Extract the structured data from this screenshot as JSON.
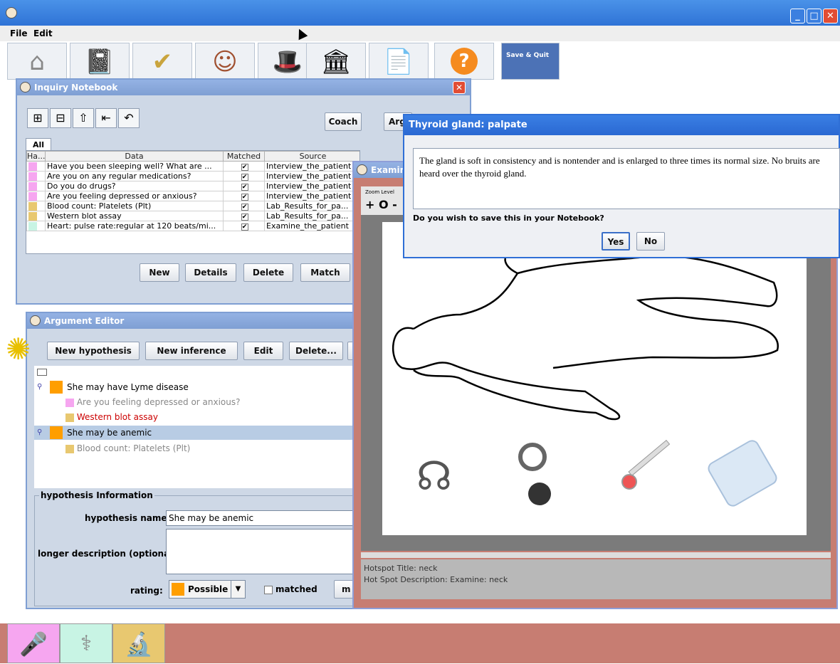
{
  "toolbar": {
    "items": [
      {
        "icon": "house-icon",
        "glyph": "⌂"
      },
      {
        "icon": "notebook-icon",
        "glyph": "📓"
      },
      {
        "icon": "checklist-icon",
        "glyph": "✔"
      },
      {
        "icon": "patient-portrait-icon",
        "glyph": "☺"
      },
      {
        "icon": "hat-icon",
        "glyph": "🎩"
      },
      {
        "icon": "library-building-icon",
        "glyph": "🏛"
      },
      {
        "icon": "report-icon",
        "glyph": "📄"
      },
      {
        "icon": "help-icon",
        "glyph": "?"
      }
    ],
    "save_quit": "Save & Quit"
  },
  "menu": {
    "file": "File",
    "edit": "Edit"
  },
  "inquiry": {
    "title": "Inquiry Notebook",
    "coach": "Coach",
    "arg": "Arg",
    "tab_all": "All",
    "columns": {
      "ha": "Ha...",
      "data": "Data",
      "matched": "Matched",
      "source": "Source"
    },
    "rows": [
      {
        "type": "mic",
        "data": "Have you been sleeping well?  What are ...",
        "matched": "✔",
        "source": "Interview_the_patient"
      },
      {
        "type": "mic",
        "data": "Are you on any regular medications?",
        "matched": "✔",
        "source": "Interview_the_patient"
      },
      {
        "type": "mic",
        "data": "Do you do drugs?",
        "matched": "✔",
        "source": "Interview_the_patient"
      },
      {
        "type": "mic",
        "data": "Are you feeling depressed or anxious?",
        "matched": "✔",
        "source": "Interview_the_patient"
      },
      {
        "type": "lab",
        "data": "Blood count: Platelets (Plt)",
        "matched": "✔",
        "source": "Lab_Results_for_pa..."
      },
      {
        "type": "lab",
        "data": "Western blot assay",
        "matched": "✔",
        "source": "Lab_Results_for_pa..."
      },
      {
        "type": "exam",
        "data": "Heart: pulse rate:regular at 120 beats/mi...",
        "matched": "✔",
        "source": "Examine_the_patient"
      }
    ],
    "buttons": {
      "new": "New",
      "details": "Details",
      "delete": "Delete",
      "match": "Match"
    }
  },
  "argument": {
    "title": "Argument Editor",
    "buttons": {
      "new_hyp": "New hypothesis",
      "new_inf": "New inference",
      "edit": "Edit",
      "delete": "Delete..."
    },
    "tree": {
      "h1": "She may have Lyme disease",
      "h1_c1": "Are you feeling depressed or anxious?",
      "h1_c2": "Western blot assay",
      "h2": "She may be anemic",
      "h2_c1": "Blood count: Platelets (Plt)"
    },
    "info": {
      "section": "hypothesis Information",
      "name_label": "hypothesis name:",
      "name_value": "She may be anemic",
      "desc_label": "longer description (optional):",
      "rating_label": "rating:",
      "rating_value": "Possible",
      "matched_label": "matched",
      "more": "m"
    }
  },
  "exam": {
    "title": "Examin",
    "zoom_label": "Zoom Level",
    "zoom_controls": "+ O -",
    "hotspot_title": "Hotspot Title: neck",
    "hotspot_desc": "Hot Spot Description: Examine: neck"
  },
  "dialog": {
    "title": "Thyroid gland: palpate",
    "text": "The gland is soft in consistency and is nontender and is enlarged to three times its normal size. No bruits are heard over the thyroid gland.",
    "question": "Do you wish to save this in your Notebook?",
    "yes": "Yes",
    "no": "No"
  },
  "colors": {
    "mic": "#f6a6f0",
    "lab": "#e8c870",
    "exam": "#c8f4e4",
    "bottom_bar": "#c77d72",
    "rating": "#ff9e00"
  }
}
